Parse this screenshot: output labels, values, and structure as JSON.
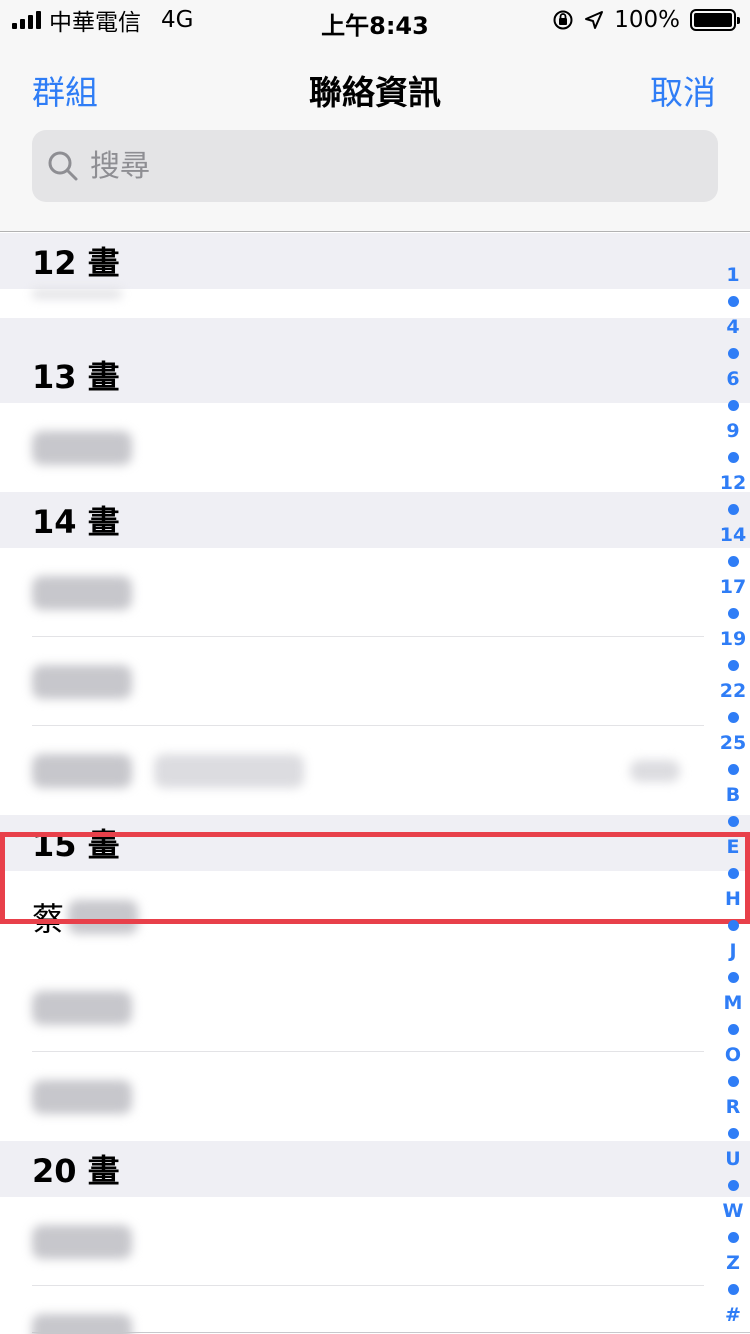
{
  "status_bar": {
    "carrier": "中華電信",
    "network": "4G",
    "time": "上午8:43",
    "battery_percent": "100%",
    "battery_level": 1.0
  },
  "nav": {
    "left_label": "群組",
    "title": "聯絡資訊",
    "right_label": "取消"
  },
  "search": {
    "placeholder": "搜尋"
  },
  "sections": [
    {
      "header": "12 畫"
    },
    {
      "header": "13 畫"
    },
    {
      "header": "14 畫"
    },
    {
      "header": "15 畫"
    },
    {
      "header": "20 畫"
    }
  ],
  "highlighted_contact": {
    "visible_name_part": "蔡"
  },
  "index_bar": [
    "1",
    "4",
    "6",
    "9",
    "12",
    "14",
    "17",
    "19",
    "22",
    "25",
    "B",
    "E",
    "H",
    "J",
    "M",
    "O",
    "R",
    "U",
    "W",
    "Z",
    "#"
  ],
  "colors": {
    "accent": "#2f7df6",
    "highlight": "#e8404a"
  }
}
